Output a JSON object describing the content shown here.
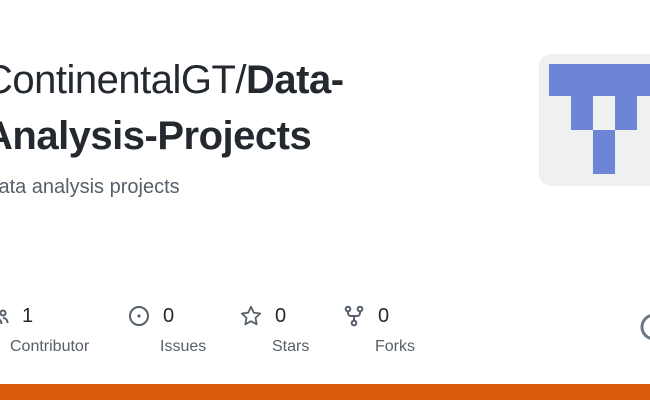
{
  "repo": {
    "owner": "ContinentalGT/",
    "name": "Data-Analysis-Projects",
    "name_line1": "Data-",
    "name_line2": "Analysis-Projects",
    "description": "Data analysis projects"
  },
  "stats": [
    {
      "icon": "people-icon",
      "value": "1",
      "label": "Contributor"
    },
    {
      "icon": "issue-icon",
      "value": "0",
      "label": "Issues"
    },
    {
      "icon": "star-icon",
      "value": "0",
      "label": "Stars"
    },
    {
      "icon": "fork-icon",
      "value": "0",
      "label": "Forks"
    }
  ],
  "colors": {
    "language_bar": "#da5b0b",
    "avatar_accent": "#6e84d6",
    "avatar_bg": "#f0f0f0"
  }
}
